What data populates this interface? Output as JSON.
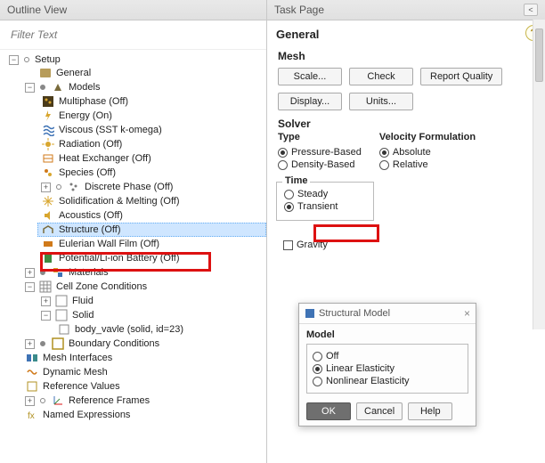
{
  "left": {
    "title": "Outline View",
    "filter_placeholder": "Filter Text",
    "tree": {
      "root": "Setup",
      "general": "General",
      "models": "Models",
      "multiphase": "Multiphase (Off)",
      "energy": "Energy (On)",
      "viscous": "Viscous (SST k-omega)",
      "radiation": "Radiation (Off)",
      "heat_exchanger": "Heat Exchanger (Off)",
      "species": "Species (Off)",
      "discrete_phase": "Discrete Phase (Off)",
      "solidification": "Solidification & Melting (Off)",
      "acoustics": "Acoustics (Off)",
      "structure": "Structure (Off)",
      "eulerian": "Eulerian Wall Film (Off)",
      "potential": "Potential/Li-ion Battery (Off)",
      "materials": "Materials",
      "cellzone": "Cell Zone Conditions",
      "fluid": "Fluid",
      "solid": "Solid",
      "body": "body_vavle (solid, id=23)",
      "boundary": "Boundary Conditions",
      "mesh_if": "Mesh Interfaces",
      "dynamic_mesh": "Dynamic Mesh",
      "ref_values": "Reference Values",
      "ref_frames": "Reference Frames",
      "named_expr": "Named Expressions"
    }
  },
  "right": {
    "title": "Task Page",
    "general": "General",
    "mesh": "Mesh",
    "scale_btn": "Scale...",
    "check_btn": "Check",
    "report_btn": "Report Quality",
    "display_btn": "Display...",
    "units_btn": "Units...",
    "solver": "Solver",
    "type": "Type",
    "vel_form": "Velocity Formulation",
    "pressure": "Pressure-Based",
    "density": "Density-Based",
    "absolute": "Absolute",
    "relative": "Relative",
    "time": "Time",
    "steady": "Steady",
    "transient": "Transient",
    "gravity": "Gravity"
  },
  "dialog": {
    "title": "Structural Model",
    "model": "Model",
    "off": "Off",
    "linear": "Linear Elasticity",
    "nonlinear": "Nonlinear Elasticity",
    "ok": "OK",
    "cancel": "Cancel",
    "help": "Help"
  }
}
